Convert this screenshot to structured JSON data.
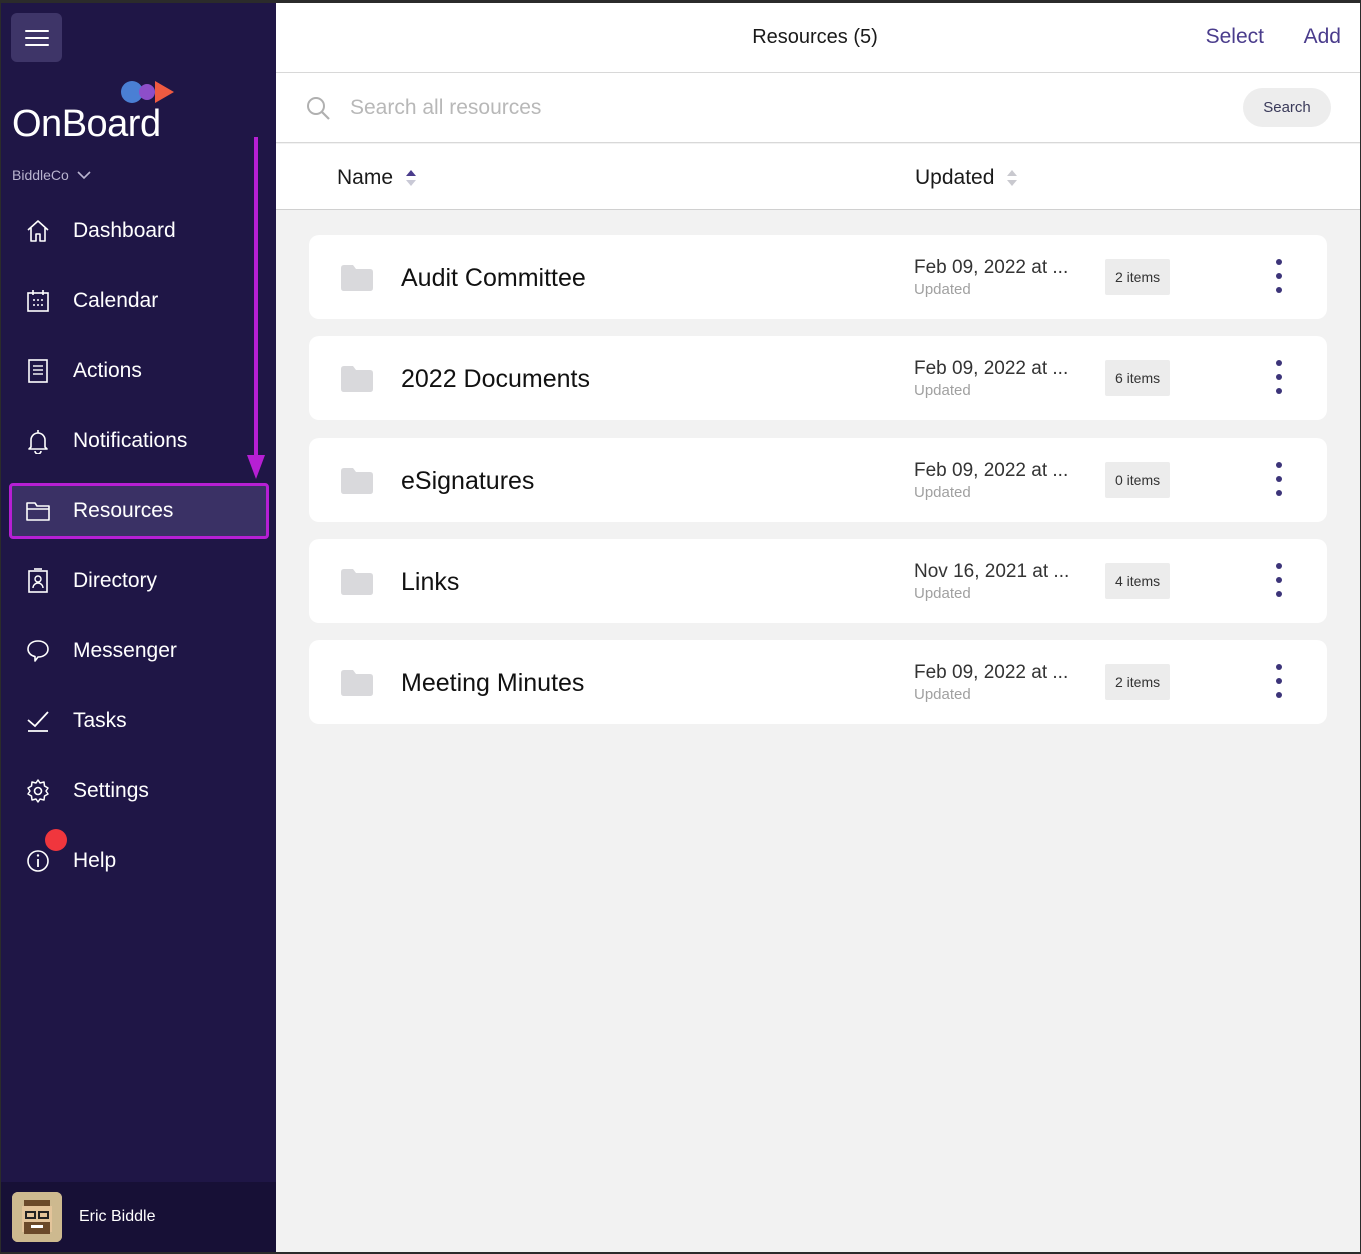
{
  "sidebar": {
    "logo_text": "OnBoard",
    "org": "BiddleCo",
    "items": [
      {
        "key": "dashboard",
        "label": "Dashboard",
        "icon": "home-icon"
      },
      {
        "key": "calendar",
        "label": "Calendar",
        "icon": "calendar-icon"
      },
      {
        "key": "actions",
        "label": "Actions",
        "icon": "actions-icon"
      },
      {
        "key": "notifications",
        "label": "Notifications",
        "icon": "bell-icon"
      },
      {
        "key": "resources",
        "label": "Resources",
        "icon": "folder-icon",
        "active": true
      },
      {
        "key": "directory",
        "label": "Directory",
        "icon": "directory-icon"
      },
      {
        "key": "messenger",
        "label": "Messenger",
        "icon": "chat-icon"
      },
      {
        "key": "tasks",
        "label": "Tasks",
        "icon": "check-icon"
      },
      {
        "key": "settings",
        "label": "Settings",
        "icon": "gear-icon"
      },
      {
        "key": "help",
        "label": "Help",
        "icon": "info-icon"
      }
    ],
    "user_name": "Eric Biddle"
  },
  "header": {
    "title": "Resources (5)",
    "select_label": "Select",
    "add_label": "Add"
  },
  "search": {
    "placeholder": "Search all resources",
    "value": "",
    "button_label": "Search"
  },
  "columns": {
    "name": "Name",
    "updated": "Updated"
  },
  "resources": [
    {
      "name": "Audit Committee",
      "date": "Feb 09, 2022 at ...",
      "updated_label": "Updated",
      "items": "2 items"
    },
    {
      "name": "2022 Documents",
      "date": "Feb 09, 2022 at ...",
      "updated_label": "Updated",
      "items": "6 items"
    },
    {
      "name": "eSignatures",
      "date": "Feb 09, 2022 at ...",
      "updated_label": "Updated",
      "items": "0 items"
    },
    {
      "name": "Links",
      "date": "Nov 16, 2021 at ...",
      "updated_label": "Updated",
      "items": "4 items"
    },
    {
      "name": "Meeting Minutes",
      "date": "Feb 09, 2022 at ...",
      "updated_label": "Updated",
      "items": "2 items"
    }
  ],
  "colors": {
    "sidebar_bg": "#1f1646",
    "accent": "#4a3c8c",
    "highlight": "#b61fd4",
    "help_dot": "#f0363d"
  }
}
